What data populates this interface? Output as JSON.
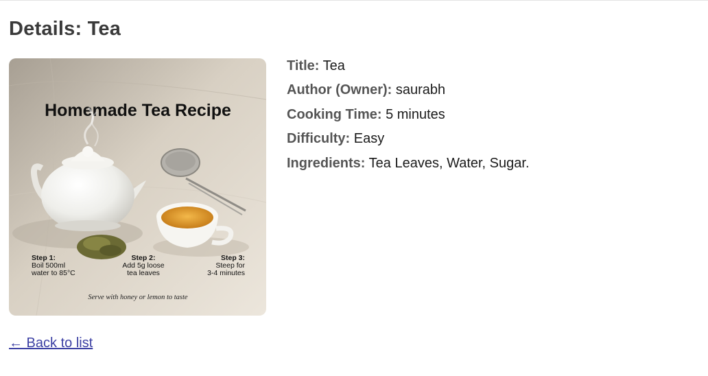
{
  "page": {
    "heading": "Details: Tea"
  },
  "image": {
    "title": "Homemade Tea Recipe",
    "step1_heading": "Step 1:",
    "step1_line1": "Boil 500ml",
    "step1_line2": "water to 85°C",
    "step2_heading": "Step 2:",
    "step2_line1": "Add 5g loose",
    "step2_line2": "tea leaves",
    "step3_heading": "Step 3:",
    "step3_line1": "Steep for",
    "step3_line2": "3-4 minutes",
    "footer": "Serve with honey or lemon to taste"
  },
  "details": {
    "title_label": "Title:",
    "title_value": "Tea",
    "author_label": "Author (Owner):",
    "author_value": "saurabh",
    "time_label": "Cooking Time:",
    "time_value": "5 minutes",
    "difficulty_label": "Difficulty:",
    "difficulty_value": "Easy",
    "ingredients_label": "Ingredients:",
    "ingredients_value": "Tea Leaves, Water, Sugar."
  },
  "nav": {
    "back_label": "← Back to list"
  }
}
